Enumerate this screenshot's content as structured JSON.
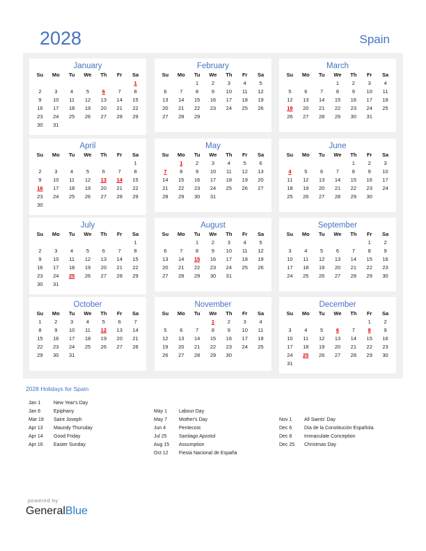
{
  "header": {
    "year": "2028",
    "country": "Spain"
  },
  "weekdays": [
    "Su",
    "Mo",
    "Tu",
    "We",
    "Th",
    "Fr",
    "Sa"
  ],
  "months": [
    {
      "name": "January",
      "offset": 6,
      "days": 31,
      "holidays": [
        1,
        6
      ]
    },
    {
      "name": "February",
      "offset": 2,
      "days": 29,
      "holidays": []
    },
    {
      "name": "March",
      "offset": 3,
      "days": 31,
      "holidays": [
        19
      ]
    },
    {
      "name": "April",
      "offset": 6,
      "days": 30,
      "holidays": [
        13,
        14,
        16
      ]
    },
    {
      "name": "May",
      "offset": 1,
      "days": 31,
      "holidays": [
        1,
        7
      ]
    },
    {
      "name": "June",
      "offset": 4,
      "days": 30,
      "holidays": [
        4
      ]
    },
    {
      "name": "July",
      "offset": 6,
      "days": 31,
      "holidays": [
        25
      ]
    },
    {
      "name": "August",
      "offset": 2,
      "days": 31,
      "holidays": [
        15
      ]
    },
    {
      "name": "September",
      "offset": 5,
      "days": 30,
      "holidays": []
    },
    {
      "name": "October",
      "offset": 0,
      "days": 31,
      "holidays": [
        12
      ]
    },
    {
      "name": "November",
      "offset": 3,
      "days": 30,
      "holidays": [
        1
      ]
    },
    {
      "name": "December",
      "offset": 5,
      "days": 31,
      "holidays": [
        6,
        8,
        25
      ]
    }
  ],
  "holidays_section": {
    "title": "2028 Holidays for Spain",
    "columns": [
      [
        {
          "date": "Jan 1",
          "name": "New Year's Day"
        },
        {
          "date": "Jan 6",
          "name": "Epiphany"
        },
        {
          "date": "Mar 19",
          "name": "Saint Joseph"
        },
        {
          "date": "Apr 13",
          "name": "Maundy Thursday"
        },
        {
          "date": "Apr 14",
          "name": "Good Friday"
        },
        {
          "date": "Apr 16",
          "name": "Easter Sunday"
        }
      ],
      [
        {
          "date": "May 1",
          "name": "Labour Day"
        },
        {
          "date": "May 7",
          "name": "Mother's Day"
        },
        {
          "date": "Jun 4",
          "name": "Pentecost"
        },
        {
          "date": "Jul 25",
          "name": "Santiago Apostol"
        },
        {
          "date": "Aug 15",
          "name": "Assumption"
        },
        {
          "date": "Oct 12",
          "name": "Fiesta Nacional de España"
        }
      ],
      [
        {
          "date": "Nov 1",
          "name": "All Saints' Day"
        },
        {
          "date": "Dec 6",
          "name": "Día de la Constitución Española"
        },
        {
          "date": "Dec 8",
          "name": "Immaculate Conception"
        },
        {
          "date": "Dec 25",
          "name": "Christmas Day"
        }
      ]
    ]
  },
  "footer": {
    "powered_by": "powered by",
    "brand_general": "General",
    "brand_blue": "Blue"
  },
  "colors": {
    "accent": "#4472c4",
    "holiday": "#e00000",
    "panel_bg": "#f0f0f0"
  }
}
